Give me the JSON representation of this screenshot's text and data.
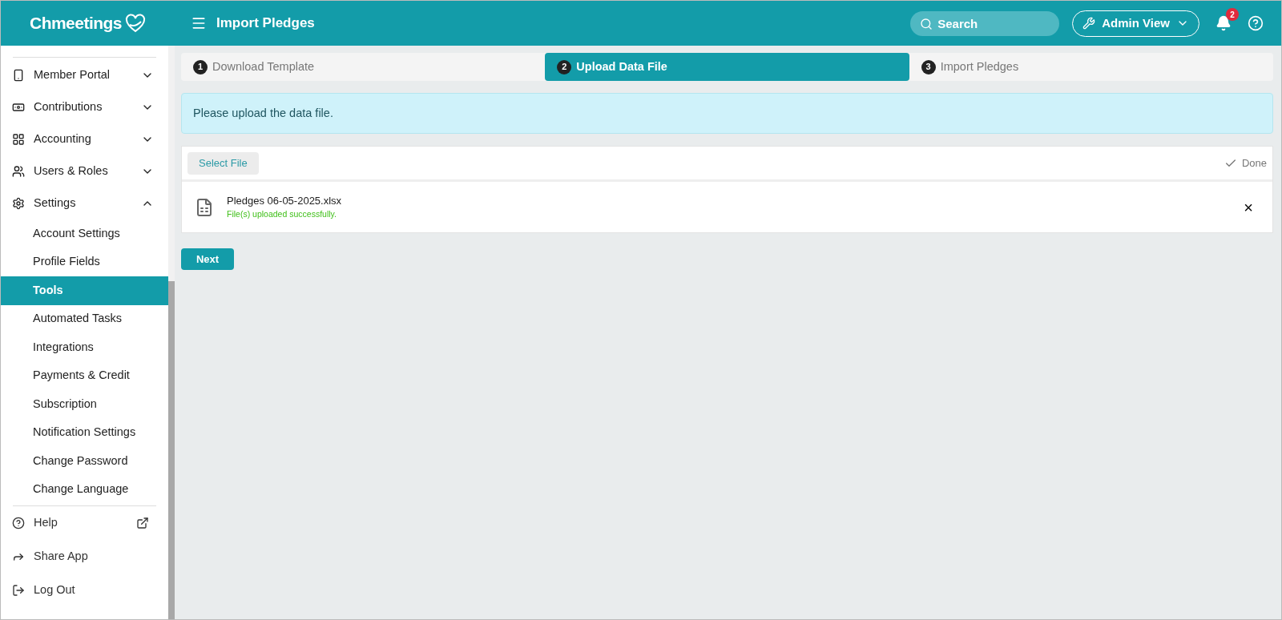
{
  "header": {
    "logo": "Chmeetings",
    "title": "Import Pledges",
    "search": {
      "placeholder": "Search"
    },
    "view_button": "Admin View",
    "notifications": "2"
  },
  "sidebar": {
    "items": [
      {
        "label": "Member Portal",
        "expanded": false
      },
      {
        "label": "Contributions",
        "expanded": false
      },
      {
        "label": "Accounting",
        "expanded": false
      },
      {
        "label": "Users & Roles",
        "expanded": false
      },
      {
        "label": "Settings",
        "expanded": true,
        "children": [
          {
            "label": "Account Settings",
            "selected": false
          },
          {
            "label": "Profile Fields",
            "selected": false
          },
          {
            "label": "Tools",
            "selected": true
          },
          {
            "label": "Automated Tasks",
            "selected": false
          },
          {
            "label": "Integrations",
            "selected": false
          },
          {
            "label": "Payments & Credit",
            "selected": false
          },
          {
            "label": "Subscription",
            "selected": false
          },
          {
            "label": "Notification Settings",
            "selected": false
          },
          {
            "label": "Change Password",
            "selected": false
          },
          {
            "label": "Change Language",
            "selected": false
          }
        ]
      }
    ],
    "footer_items": [
      {
        "label": "Help"
      },
      {
        "label": "Share App"
      },
      {
        "label": "Log Out"
      }
    ]
  },
  "steps": [
    {
      "number": "1",
      "label": "Download Template",
      "selected": false
    },
    {
      "number": "2",
      "label": "Upload Data File",
      "selected": true
    },
    {
      "number": "3",
      "label": "Import Pledges",
      "selected": false
    }
  ],
  "alert": "Please upload the data file.",
  "upload": {
    "select_button": "Select File",
    "done_button": "Done",
    "files": [
      {
        "name": "Pledges 06-05-2025.xlsx",
        "status": "File(s) uploaded successfully.",
        "remove": "×"
      }
    ]
  },
  "next_button": "Next"
}
